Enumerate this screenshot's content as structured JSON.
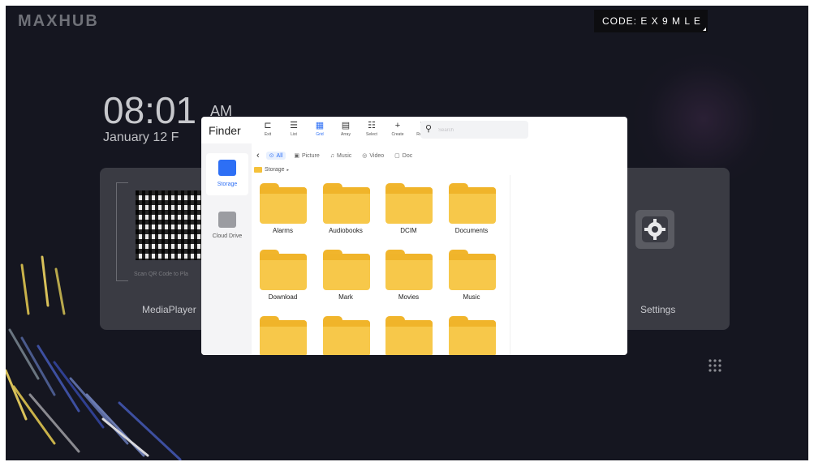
{
  "brand": "MAXHUB",
  "code": {
    "label": "CODE: E X 9 M L E"
  },
  "clock": {
    "time": "08:01",
    "ampm": "AM",
    "date": "January 12 F"
  },
  "home_tiles": {
    "qr_caption": "Scan QR Code to Pla",
    "mediaplayer": "MediaPlayer",
    "settings": "Settings"
  },
  "finder": {
    "title": "Finder",
    "toolbar": [
      {
        "label": "Exit",
        "icon": "exit-icon",
        "glyph": "⊏"
      },
      {
        "label": "List",
        "icon": "list-icon",
        "glyph": "☰"
      },
      {
        "label": "Grid",
        "icon": "grid-icon",
        "glyph": "▦",
        "active": true
      },
      {
        "label": "Array",
        "icon": "array-icon",
        "glyph": "▤"
      },
      {
        "label": "Select",
        "icon": "select-icon",
        "glyph": "☷"
      },
      {
        "label": "Create",
        "icon": "plus-icon",
        "glyph": "+"
      },
      {
        "label": "Refresh",
        "icon": "refresh-icon",
        "glyph": "↻"
      }
    ],
    "search": {
      "placeholder": "Search"
    },
    "sidebar": [
      {
        "label": "Storage",
        "icon": "storage-icon",
        "selected": true,
        "color": "#2d6ff5"
      },
      {
        "label": "Cloud Drive",
        "icon": "cloud-drive-icon",
        "selected": false,
        "color": "#9b9ca1"
      }
    ],
    "filters": [
      {
        "label": "All",
        "glyph": "⊙",
        "active": true
      },
      {
        "label": "Picture",
        "glyph": "▣"
      },
      {
        "label": "Music",
        "glyph": "♫"
      },
      {
        "label": "Video",
        "glyph": "◎"
      },
      {
        "label": "Doc",
        "glyph": "▢"
      }
    ],
    "breadcrumb": {
      "label": "Storage",
      "arrow": "▸"
    },
    "folders": [
      "Alarms",
      "Audiobooks",
      "DCIM",
      "Documents",
      "Download",
      "Mark",
      "Movies",
      "Music",
      "",
      "",
      "",
      ""
    ]
  },
  "colors": {
    "accent": "#2d6ff5",
    "folder": "#f7c84a",
    "background": "#151620"
  }
}
